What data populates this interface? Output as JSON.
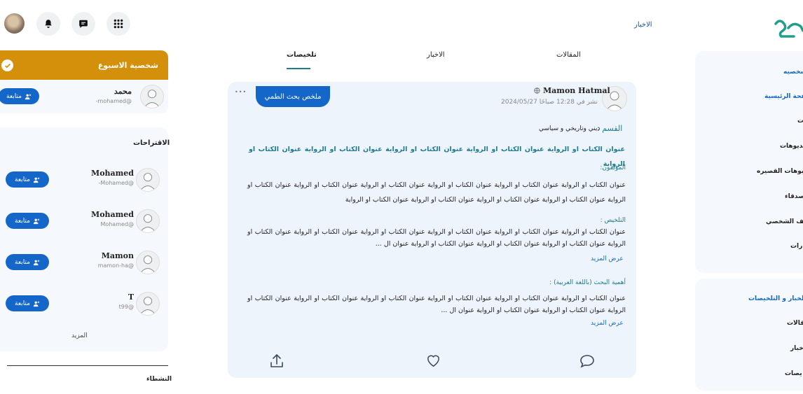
{
  "header": {
    "news_link": "الاخبار"
  },
  "week_card": {
    "title": "شخصية الاسبوع",
    "user": {
      "name": "محمد",
      "handle": "-mohamed@",
      "follow": "متابعة"
    }
  },
  "suggestions": {
    "title": "الاقتراحات",
    "users": [
      {
        "name": "Mohamed",
        "handle": "-Mohamed@",
        "follow": "متابعة"
      },
      {
        "name": "Mohamed",
        "handle": "Mohamed@",
        "follow": "متابعة"
      },
      {
        "name": "Mamon",
        "handle": "mamon-ha@",
        "follow": "متابعة"
      },
      {
        "name": "T",
        "handle": "t99@",
        "follow": "متابعة"
      }
    ],
    "more": "المزيد"
  },
  "activists": {
    "title": "النشطاء"
  },
  "tabs": {
    "articles": "المقالات",
    "news": "الاخبار",
    "summaries": "تلخيصات"
  },
  "post": {
    "author": "Mamon Hatmal",
    "date": "نشر في 12:28 صباحًا 2024/05/27",
    "tag": "ملخص بحث الطمي",
    "more_dots": "•••",
    "category_label": "القسم :",
    "category_value": "ديني وتاريخي و سياسي",
    "title": "عنوان الكتاب او الرواية عنوان الكتاب او الرواية عنوان الكتاب او الرواية عنوان الكتاب او الرواية عنوان الكتاب او الرواية",
    "authors_label": "المؤلفون:",
    "authors_text": "عنوان الكتاب او الرواية عنوان الكتاب او الرواية عنوان الكتاب او الرواية عنوان الكتاب او الرواية عنوان الكتاب او الرواية عنوان الكتاب او الرواية عنوان الكتاب او الرواية عنوان الكتاب او الرواية عنوان الكتاب او الرواية عنوان الكتاب او الرواية",
    "summary_label": "التلخيص :",
    "summary_text": "عنوان الكتاب او الرواية عنوان الكتاب او الرواية عنوان الكتاب او الرواية عنوان الكتاب او الرواية عنوان الكتاب او الرواية عنوان الكتاب او الرواية عنوان الكتاب او الرواية عنوان الكتاب او الرواية عنوان الكتاب او الرواية عنوان ال ...",
    "summary_more": "عرض المزيد",
    "importance_label": "أهمية البحث (باللغة العربية) :",
    "importance_text": "عنوان الكتاب او الرواية عنوان الكتاب او الرواية عنوان الكتاب او الرواية عنوان الكتاب او الرواية عنوان الكتاب او الرواية عنوان الكتاب او الرواية عنوان الكتاب او الرواية عنوان الكتاب او الرواية عنوان ال ...",
    "importance_more": "عرض المزيد"
  },
  "right_sidebar": {
    "menu": [
      "شخصيه",
      "صفحة الرئيسية",
      "ت",
      "يديوهات",
      "يديوهات القصيره",
      "صدقاء",
      "لف الشخصي",
      "رات"
    ],
    "menu2_title": "الخبار و التلخيصات",
    "menu2": [
      "قالات",
      "خبار",
      "يصات"
    ]
  },
  "colors": {
    "accent": "#1467c9",
    "week": "#d4900a",
    "teal": "#1f7a8c"
  }
}
